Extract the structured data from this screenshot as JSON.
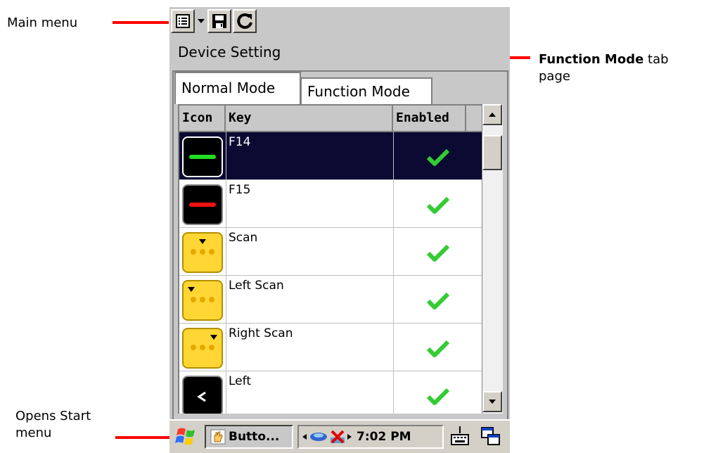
{
  "annotations": {
    "main_menu": "Main menu",
    "function_mode_bold": "Function Mode",
    "function_mode_rest": " tab",
    "function_mode_line2": "page",
    "start_menu_line1": "Opens Start",
    "start_menu_line2": "menu"
  },
  "toolbar": {
    "menu_icon": "list-icon",
    "dropdown_icon": "chevron-down-icon",
    "save_icon": "floppy-disk-icon",
    "refresh_icon": "refresh-icon"
  },
  "title": "Device Setting",
  "tabs": {
    "normal": "Normal Mode",
    "function": "Function Mode"
  },
  "grid": {
    "headers": {
      "icon": "Icon",
      "key": "Key",
      "enabled": "Enabled"
    },
    "rows": [
      {
        "key": "F14",
        "icon": "green-dash-key-icon",
        "enabled": true
      },
      {
        "key": "F15",
        "icon": "red-dash-key-icon",
        "enabled": true
      },
      {
        "key": "Scan",
        "icon": "scan-key-icon",
        "enabled": true
      },
      {
        "key": "Left Scan",
        "icon": "left-scan-key-icon",
        "enabled": true
      },
      {
        "key": "Right Scan",
        "icon": "right-scan-key-icon",
        "enabled": true
      },
      {
        "key": "Left",
        "icon": "left-arrow-key-icon",
        "enabled": true
      }
    ]
  },
  "taskbar": {
    "task_label": "Butto...",
    "time": "7:02 PM"
  },
  "colors": {
    "selected_row": "#0a0a32",
    "check": "#33cc33",
    "annotation_line": "#ff0000",
    "key_yellow": "#ffd633"
  }
}
